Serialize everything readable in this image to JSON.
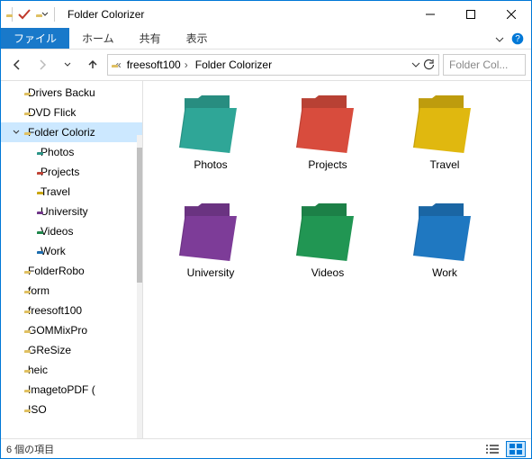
{
  "window": {
    "title": "Folder Colorizer"
  },
  "ribbon": {
    "file": "ファイル",
    "tabs": [
      "ホーム",
      "共有",
      "表示"
    ]
  },
  "address": {
    "crumbs": [
      "freesoft100",
      "Folder Colorizer"
    ]
  },
  "search": {
    "placeholder": "Folder Col..."
  },
  "tree": {
    "items": [
      {
        "label": "Drivers Backu",
        "color": "#f8d56e",
        "depth": 1,
        "sel": false
      },
      {
        "label": "DVD Flick",
        "color": "#f8d56e",
        "depth": 1,
        "sel": false
      },
      {
        "label": "Folder Coloriz",
        "color": "#f8d56e",
        "depth": 1,
        "sel": true,
        "expanded": true
      },
      {
        "label": "Photos",
        "color": "#2fa697",
        "depth": 2,
        "sel": false
      },
      {
        "label": "Projects",
        "color": "#d84c3d",
        "depth": 2,
        "sel": false
      },
      {
        "label": "Travel",
        "color": "#e0b80f",
        "depth": 2,
        "sel": false
      },
      {
        "label": "University",
        "color": "#7d3c98",
        "depth": 2,
        "sel": false
      },
      {
        "label": "Videos",
        "color": "#219653",
        "depth": 2,
        "sel": false
      },
      {
        "label": "Work",
        "color": "#1f78c1",
        "depth": 2,
        "sel": false
      },
      {
        "label": "FolderRobo",
        "color": "#f8d56e",
        "depth": 1,
        "sel": false
      },
      {
        "label": "form",
        "color": "#f8d56e",
        "depth": 1,
        "sel": false
      },
      {
        "label": "freesoft100",
        "color": "#f8d56e",
        "depth": 1,
        "sel": false
      },
      {
        "label": "GOMMixPro",
        "color": "#f8d56e",
        "depth": 1,
        "sel": false
      },
      {
        "label": "GReSize",
        "color": "#f8d56e",
        "depth": 1,
        "sel": false
      },
      {
        "label": "heic",
        "color": "#f8d56e",
        "depth": 1,
        "sel": false
      },
      {
        "label": "ImagetoPDF (",
        "color": "#f8d56e",
        "depth": 1,
        "sel": false
      },
      {
        "label": "ISO",
        "color": "#f8d56e",
        "depth": 1,
        "sel": false
      }
    ]
  },
  "folders": [
    {
      "label": "Photos",
      "color": "#2fa697"
    },
    {
      "label": "Projects",
      "color": "#d84c3d"
    },
    {
      "label": "Travel",
      "color": "#e0b80f"
    },
    {
      "label": "University",
      "color": "#7d3c98"
    },
    {
      "label": "Videos",
      "color": "#219653"
    },
    {
      "label": "Work",
      "color": "#1f78c1"
    }
  ],
  "status": {
    "text": "6 個の項目"
  }
}
